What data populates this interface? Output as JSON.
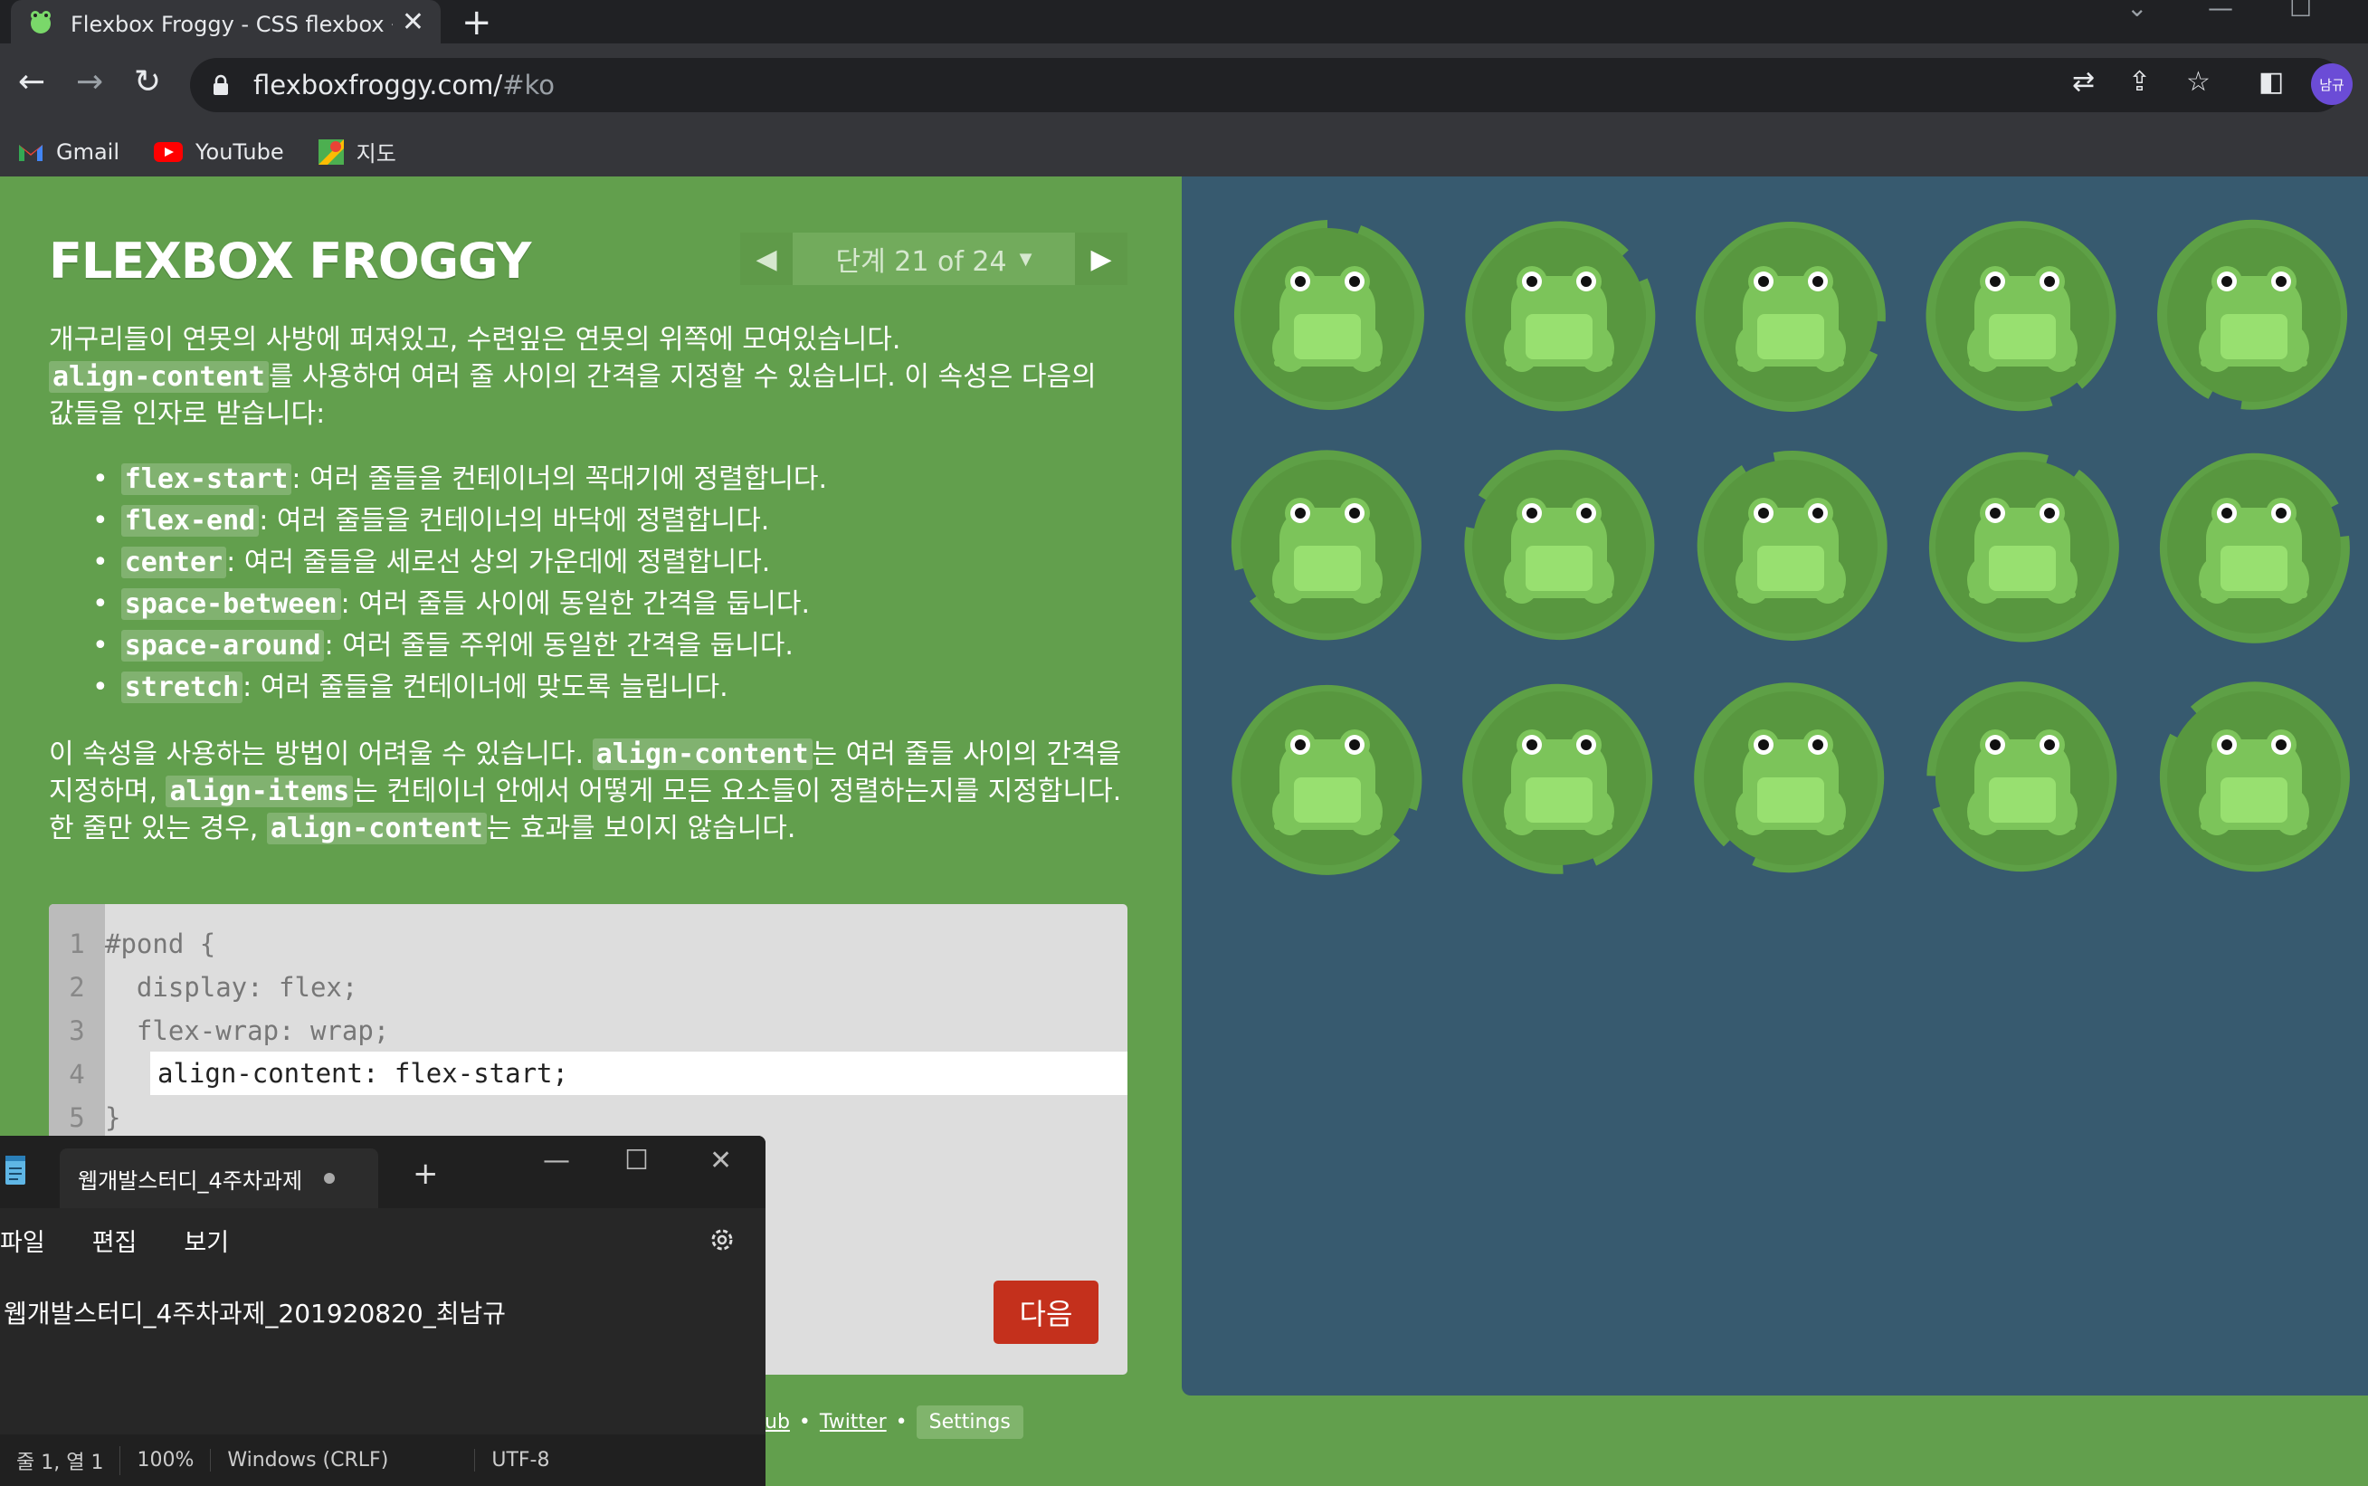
{
  "browser": {
    "tab_title": "Flexbox Froggy - CSS flexbox 속",
    "url_host": "flexboxfroggy.com/",
    "url_hash": "#ko",
    "avatar_text": "남규",
    "bookmarks": [
      {
        "label": "Gmail",
        "icon": "gmail-icon"
      },
      {
        "label": "YouTube",
        "icon": "youtube-icon"
      },
      {
        "label": "지도",
        "icon": "maps-icon"
      }
    ]
  },
  "game": {
    "logo": "FLEXBOX FROGGY",
    "level_label": "단계 21 of 24",
    "intro_1": "개구리들이 연못의 사방에 퍼져있고, 수련잎은 연못의 위쪽에 모여있습니다.",
    "intro_code": "align-content",
    "intro_2": "를 사용하여 여러 줄 사이의 간격을 지정할 수 있습니다. 이 속성은 다음의 값들을 인자로 받습니다:",
    "options": [
      {
        "code": "flex-start",
        "desc": ": 여러 줄들을 컨테이너의 꼭대기에 정렬합니다."
      },
      {
        "code": "flex-end",
        "desc": ": 여러 줄들을 컨테이너의 바닥에 정렬합니다."
      },
      {
        "code": "center",
        "desc": ": 여러 줄들을 세로선 상의 가운데에 정렬합니다."
      },
      {
        "code": "space-between",
        "desc": ": 여러 줄들 사이에 동일한 간격을 둡니다."
      },
      {
        "code": "space-around",
        "desc": ": 여러 줄들 주위에 동일한 간격을 둡니다."
      },
      {
        "code": "stretch",
        "desc": ": 여러 줄들을 컨테이너에 맞도록 늘립니다."
      }
    ],
    "outro_1": "이 속성을 사용하는 방법이 어려울 수 있습니다. ",
    "outro_code1": "align-content",
    "outro_2": "는 여러 줄들 사이의 간격을 지정하며, ",
    "outro_code2": "align-items",
    "outro_3": "는 컨테이너 안에서 어떻게 모든 요소들이 정렬하는지를 지정합니다. 한 줄만 있는 경우, ",
    "outro_code3": "align-content",
    "outro_4": "는 효과를 보이지 않습니다.",
    "code_lines": [
      "#pond {",
      "  display: flex;",
      "  flex-wrap: wrap;",
      "",
      "}"
    ],
    "line_numbers": [
      "1",
      "2",
      "3",
      "4",
      "5"
    ],
    "input_value": "align-content: flex-start;",
    "next_button": "다음",
    "footer_github": "ub",
    "footer_twitter": "Twitter",
    "footer_settings": "Settings",
    "frog_count": 15,
    "colors": {
      "bg": "#629f4d",
      "pond": "#375a6f",
      "lily": "#5ea046",
      "frog": "#98e070",
      "next": "#c4301c"
    }
  },
  "notepad": {
    "tab_title": "웹개발스터디_4주차과제",
    "menu": [
      "파일",
      "편집",
      "보기"
    ],
    "content": "웹개발스터디_4주차과제_201920820_최남규",
    "status": [
      "줄 1, 열 1",
      "100%",
      "Windows (CRLF)",
      "UTF-8"
    ]
  }
}
